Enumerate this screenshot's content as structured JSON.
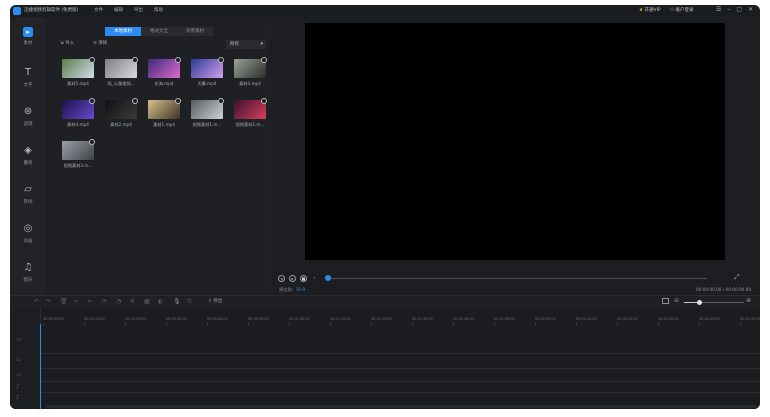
{
  "titlebar": {
    "app_title": "迅捷视频剪辑软件 (免费版)",
    "menus": [
      "文件",
      "编辑",
      "导出",
      "帮助"
    ],
    "vip": "开通VIP",
    "account": "账户登录",
    "controls": [
      "☰",
      "–",
      "▢",
      "✕"
    ]
  },
  "autosave": "最近保存 15:07",
  "sidebar": {
    "items": [
      {
        "label": "素材",
        "icon": "import-icon"
      },
      {
        "label": "文字",
        "icon": "text-icon"
      },
      {
        "label": "滤镜",
        "icon": "filter-icon"
      },
      {
        "label": "叠附",
        "icon": "overlay-icon"
      },
      {
        "label": "转场",
        "icon": "transition-icon"
      },
      {
        "label": "动画",
        "icon": "animation-icon"
      },
      {
        "label": "配乐",
        "icon": "music-icon"
      }
    ]
  },
  "media": {
    "tabs": [
      "本地素材",
      "格式大全",
      "背景素材"
    ],
    "import_label": "导入",
    "delete_label": "清除",
    "filter_value": "所有",
    "clips": [
      {
        "name": "素材5.mp4",
        "c1": "#5c7a4a",
        "c2": "#cfe0ea"
      },
      {
        "name": "雨_公路视频...",
        "c1": "#7c7f82",
        "c2": "#d8dadc"
      },
      {
        "name": "花海.mp4",
        "c1": "#3a2b7a",
        "c2": "#e06ad0"
      },
      {
        "name": "天幕.mp4",
        "c1": "#2a3a9a",
        "c2": "#d5a0e8"
      },
      {
        "name": "素材3.mp4",
        "c1": "#9aa39a",
        "c2": "#2a2c2a"
      },
      {
        "name": "素材4.mp4",
        "c1": "#1a1248",
        "c2": "#6b4ad0"
      },
      {
        "name": "素材2.mp4",
        "c1": "#101010",
        "c2": "#3c3c3c"
      },
      {
        "name": "素材1.mp4",
        "c1": "#d9c28a",
        "c2": "#3a3228"
      },
      {
        "name": "视频素材1.m...",
        "c1": "#555a5e",
        "c2": "#cfd3d6"
      },
      {
        "name": "视频素材2.m...",
        "c1": "#3a1030",
        "c2": "#d8405a"
      },
      {
        "name": "视频素材3.m...",
        "c1": "#9aa0a6",
        "c2": "#3e4246"
      }
    ]
  },
  "preview": {
    "ratio_label": "原比例：",
    "ratio_value": "16:9",
    "timecode": "00:00:00.00 / 00:00:00.00",
    "progress": 0.0
  },
  "toolbar": {
    "export_label": "导出",
    "zoom_level": 0.25
  },
  "timeline": {
    "ticks": [
      "00:00:00:00",
      "00:00:10:00",
      "00:00:20:00",
      "00:00:30:00",
      "00:00:40:00",
      "00:00:50:00",
      "00:01:00:00",
      "00:01:10:00",
      "00:01:20:00",
      "00:01:30:00",
      "00:01:40:00",
      "00:01:50:00",
      "00:02:00:00",
      "00:02:10:00",
      "00:02:20:00",
      "00:02:30:00",
      "00:02:40:00",
      "00:02:50:00"
    ]
  },
  "colors": {
    "accent": "#2d8cf0",
    "bg": "#1d1e22"
  }
}
